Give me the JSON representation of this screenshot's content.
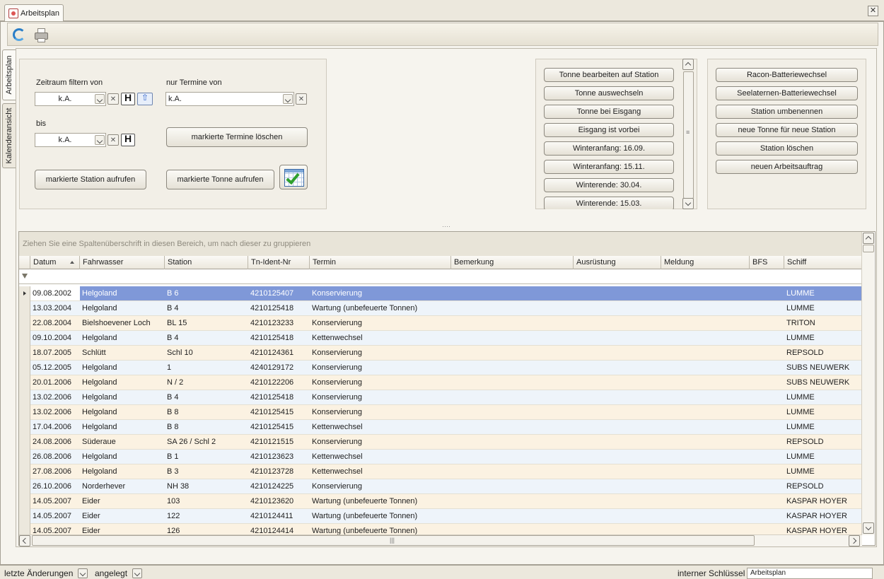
{
  "tab": {
    "title": "Arbeitsplan"
  },
  "side_tabs": [
    "Arbeitsplan",
    "Kalenderansicht"
  ],
  "filter": {
    "zeitraum_label": "Zeitraum filtern von",
    "von_value": "k.A.",
    "bis_label": "bis",
    "bis_value": "k.A.",
    "nur_termine_label": "nur Termine von",
    "nur_termine_value": "k.A.",
    "h_label": "H",
    "delete_marked_label": "markierte Termine löschen",
    "call_station_label": "markierte Station aufrufen",
    "call_tonne_label": "markierte Tonne aufrufen"
  },
  "mid_buttons": [
    "Tonne bearbeiten auf Station",
    "Tonne auswechseln",
    "Tonne bei Eisgang",
    "Eisgang ist vorbei",
    "Winteranfang: 16.09.",
    "Winteranfang: 15.11.",
    "Winterende: 30.04.",
    "Winterende: 15.03."
  ],
  "right_buttons": [
    "Racon-Batteriewechsel",
    "Seelaternen-Batteriewechsel",
    "Station umbenennen",
    "neue Tonne für neue Station",
    "Station löschen",
    "neuen Arbeitsauftrag"
  ],
  "grid": {
    "group_hint": "Ziehen Sie eine Spaltenüberschrift in diesen Bereich, um nach dieser zu gruppieren",
    "columns": [
      "Datum",
      "Fahrwasser",
      "Station",
      "Tn-Ident-Nr",
      "Termin",
      "Bemerkung",
      "Ausrüstung",
      "Meldung",
      "BFS",
      "Schiff"
    ],
    "sort_column": "Datum",
    "rows": [
      [
        "09.08.2002",
        "Helgoland",
        "B 6",
        "4210125407",
        "Konservierung",
        "",
        "",
        "",
        "",
        "LUMME"
      ],
      [
        "13.03.2004",
        "Helgoland",
        "B 4",
        "4210125418",
        "Wartung (unbefeuerte Tonnen)",
        "",
        "",
        "",
        "",
        "LUMME"
      ],
      [
        "22.08.2004",
        "Bielshoevener Loch",
        "BL 15",
        "4210123233",
        "Konservierung",
        "",
        "",
        "",
        "",
        "TRITON"
      ],
      [
        "09.10.2004",
        "Helgoland",
        "B 4",
        "4210125418",
        "Kettenwechsel",
        "",
        "",
        "",
        "",
        "LUMME"
      ],
      [
        "18.07.2005",
        "Schlütt",
        "Schl 10",
        "4210124361",
        "Konservierung",
        "",
        "",
        "",
        "",
        "REPSOLD"
      ],
      [
        "05.12.2005",
        "Helgoland",
        "1",
        "4240129172",
        "Konservierung",
        "",
        "",
        "",
        "",
        "SUBS NEUWERK"
      ],
      [
        "20.01.2006",
        "Helgoland",
        "N / 2",
        "4210122206",
        "Konservierung",
        "",
        "",
        "",
        "",
        "SUBS NEUWERK"
      ],
      [
        "13.02.2006",
        "Helgoland",
        "B 4",
        "4210125418",
        "Konservierung",
        "",
        "",
        "",
        "",
        "LUMME"
      ],
      [
        "13.02.2006",
        "Helgoland",
        "B 8",
        "4210125415",
        "Konservierung",
        "",
        "",
        "",
        "",
        "LUMME"
      ],
      [
        "17.04.2006",
        "Helgoland",
        "B 8",
        "4210125415",
        "Kettenwechsel",
        "",
        "",
        "",
        "",
        "LUMME"
      ],
      [
        "24.08.2006",
        "Süderaue",
        "SA 26 / Schl 2",
        "4210121515",
        "Konservierung",
        "",
        "",
        "",
        "",
        "REPSOLD"
      ],
      [
        "26.08.2006",
        "Helgoland",
        "B 1",
        "4210123623",
        "Kettenwechsel",
        "",
        "",
        "",
        "",
        "LUMME"
      ],
      [
        "27.08.2006",
        "Helgoland",
        "B 3",
        "4210123728",
        "Kettenwechsel",
        "",
        "",
        "",
        "",
        "LUMME"
      ],
      [
        "26.10.2006",
        "Norderhever",
        "NH 38",
        "4210124225",
        "Konservierung",
        "",
        "",
        "",
        "",
        "REPSOLD"
      ],
      [
        "14.05.2007",
        "Eider",
        "103",
        "4210123620",
        "Wartung (unbefeuerte Tonnen)",
        "",
        "",
        "",
        "",
        "KASPAR HOYER"
      ],
      [
        "14.05.2007",
        "Eider",
        "122",
        "4210124411",
        "Wartung (unbefeuerte Tonnen)",
        "",
        "",
        "",
        "",
        "KASPAR HOYER"
      ],
      [
        "14.05.2007",
        "Eider",
        "126",
        "4210124414",
        "Wartung (unbefeuerte Tonnen)",
        "",
        "",
        "",
        "",
        "KASPAR HOYER"
      ]
    ]
  },
  "status": {
    "last_changes_label": "letzte Änderungen",
    "created_label": "angelegt",
    "internal_key_label": "interner Schlüssel",
    "internal_key_value": "Arbeitsplan"
  },
  "icons": {
    "refresh": "refresh-icon",
    "print": "printer-icon",
    "calendar": "calendar-check-icon"
  }
}
